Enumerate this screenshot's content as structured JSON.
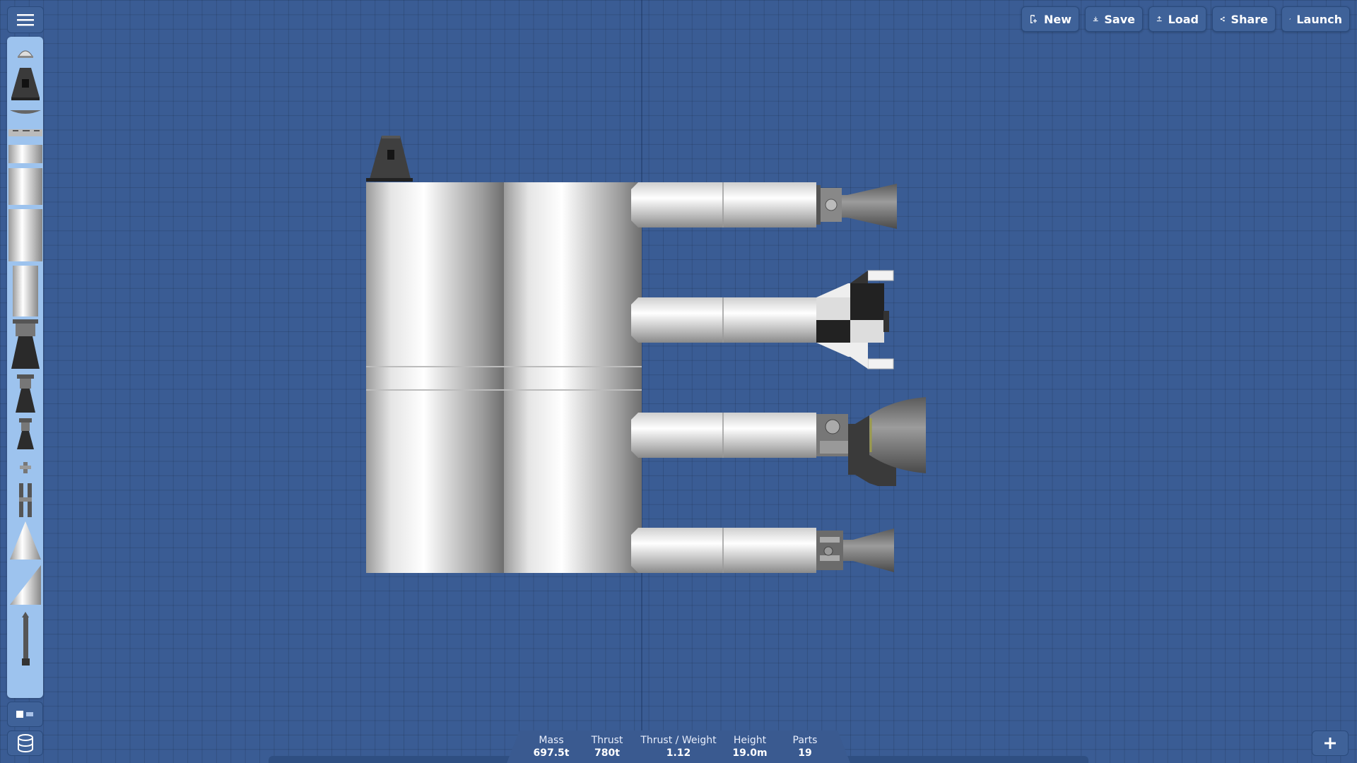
{
  "toolbar": {
    "new_label": "New",
    "save_label": "Save",
    "load_label": "Load",
    "share_label": "Share",
    "launch_label": "Launch"
  },
  "stats": {
    "mass_label": "Mass",
    "mass_value": "697.5t",
    "thrust_label": "Thrust",
    "thrust_value": "780t",
    "twr_label": "Thrust / Weight",
    "twr_value": "1.12",
    "height_label": "Height",
    "height_value": "19.0m",
    "parts_label": "Parts",
    "parts_value": "19"
  },
  "parts_panel": {
    "items": [
      "probe-icon",
      "capsule-icon",
      "heat-shield-icon",
      "decoupler-icon",
      "fuel-tank-small-icon",
      "fuel-tank-medium-icon",
      "fuel-tank-large-icon",
      "fuel-tank-xl-icon",
      "engine-large-icon",
      "engine-medium-icon",
      "engine-small-icon",
      "rcs-icon",
      "separator-icon",
      "nose-cone-icon",
      "fairing-icon",
      "parachute-icon"
    ]
  },
  "colors": {
    "background": "#3a5c94",
    "panel": "#9dc3ee",
    "button": "#3f6299"
  }
}
